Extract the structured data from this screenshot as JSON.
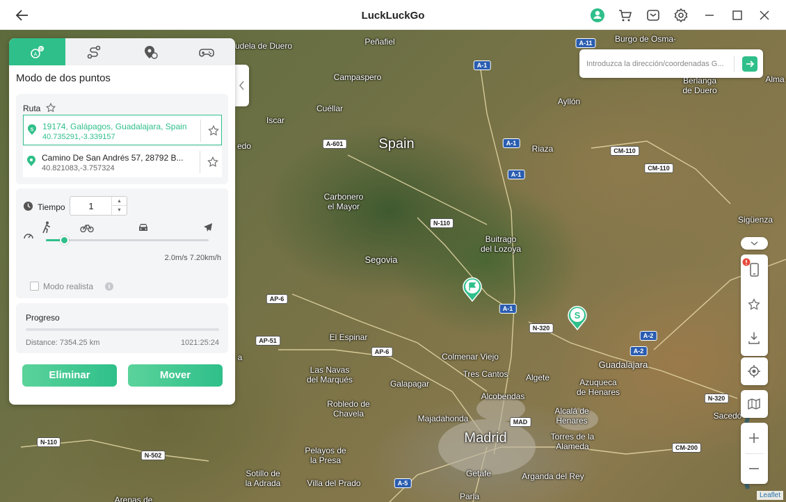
{
  "app": {
    "title": "LuckLuckGo"
  },
  "search": {
    "placeholder": "Introduzca la dirección/coordenadas G..."
  },
  "panel": {
    "title": "Modo de dos puntos",
    "route_label": "Ruta",
    "points": [
      {
        "address": "19174, Galápagos, Guadalajara, Spain",
        "coords": "40.735291,-3.339157"
      },
      {
        "address": "Camino De San Andrés 57, 28792 B...",
        "coords": "40.821083,-3.757324"
      }
    ],
    "time_label": "Tiempo",
    "time_value": "1",
    "speed_fraction": 0.11,
    "speed_text": "2.0m/s  7.20km/h",
    "realista_label": "Modo realista",
    "realista_info": "i",
    "progress_label": "Progreso",
    "progress_fraction": 0,
    "distance": "Distance: 7354.25 km",
    "duration": "1021:25:24",
    "delete_label": "Eliminar",
    "move_label": "Mover"
  },
  "map": {
    "attribution": "Leaflet",
    "places": [
      {
        "name": "Spain",
        "size": "big"
      },
      {
        "name": "Segovia",
        "size": "mid"
      },
      {
        "name": "Madrid",
        "size": "big"
      },
      {
        "name": "Guadalajara",
        "size": "mid"
      },
      {
        "name": "Peñafiel"
      },
      {
        "name": "Cuéllar"
      },
      {
        "name": "Campaspero"
      },
      {
        "name": "Iscar"
      },
      {
        "name": "Carbonero\nel Mayor"
      },
      {
        "name": "Buitrago\ndel Lozoya"
      },
      {
        "name": "Riaza"
      },
      {
        "name": "Ayllón"
      },
      {
        "name": "Burgo de Osma-"
      },
      {
        "name": "El Espinar"
      },
      {
        "name": "Colmenar Viejo"
      },
      {
        "name": "Tres Cantos"
      },
      {
        "name": "Algete"
      },
      {
        "name": "Azuqueca\nde Henares"
      },
      {
        "name": "Alcobendas"
      },
      {
        "name": "Galapagar"
      },
      {
        "name": "Las Navas\ndel Marqués"
      },
      {
        "name": "Robledo de\nChavela"
      },
      {
        "name": "Majadahonda"
      },
      {
        "name": "Alcalá de\nHenares"
      },
      {
        "name": "Torres de la\nAlameda"
      },
      {
        "name": "Pelayos de\nla Presa"
      },
      {
        "name": "Sotillo de\nla Adrada"
      },
      {
        "name": "Villa del Prado"
      },
      {
        "name": "Getafe"
      },
      {
        "name": "Arganda del Rey"
      },
      {
        "name": "Parla"
      },
      {
        "name": "Sigüenza"
      },
      {
        "name": "Berlanga\nde Duero"
      },
      {
        "name": "Alma"
      },
      {
        "name": "Sacedó"
      },
      {
        "name": "udela de Duero"
      },
      {
        "name": "edo"
      },
      {
        "name": "a"
      },
      {
        "name": "Arenas de"
      }
    ],
    "shields": [
      "A-1",
      "A-11",
      "A-601",
      "A-1",
      "A-1",
      "CM-110",
      "CM-110",
      "N-110",
      "A-1",
      "N-320",
      "AP-6",
      "AP-51",
      "AP-6",
      "A-2",
      "A-2",
      "N-320",
      "CM-200",
      "N-110",
      "N-502",
      "A-5",
      "MAD"
    ]
  },
  "icons": {
    "back": "back-arrow-icon",
    "user": "user-icon",
    "cart": "cart-icon",
    "mail": "mail-icon",
    "settings": "gear-icon",
    "minimize": "minimize-icon",
    "maximize": "maximize-icon",
    "close": "close-icon"
  },
  "colors": {
    "accent": "#2fbf8a"
  }
}
